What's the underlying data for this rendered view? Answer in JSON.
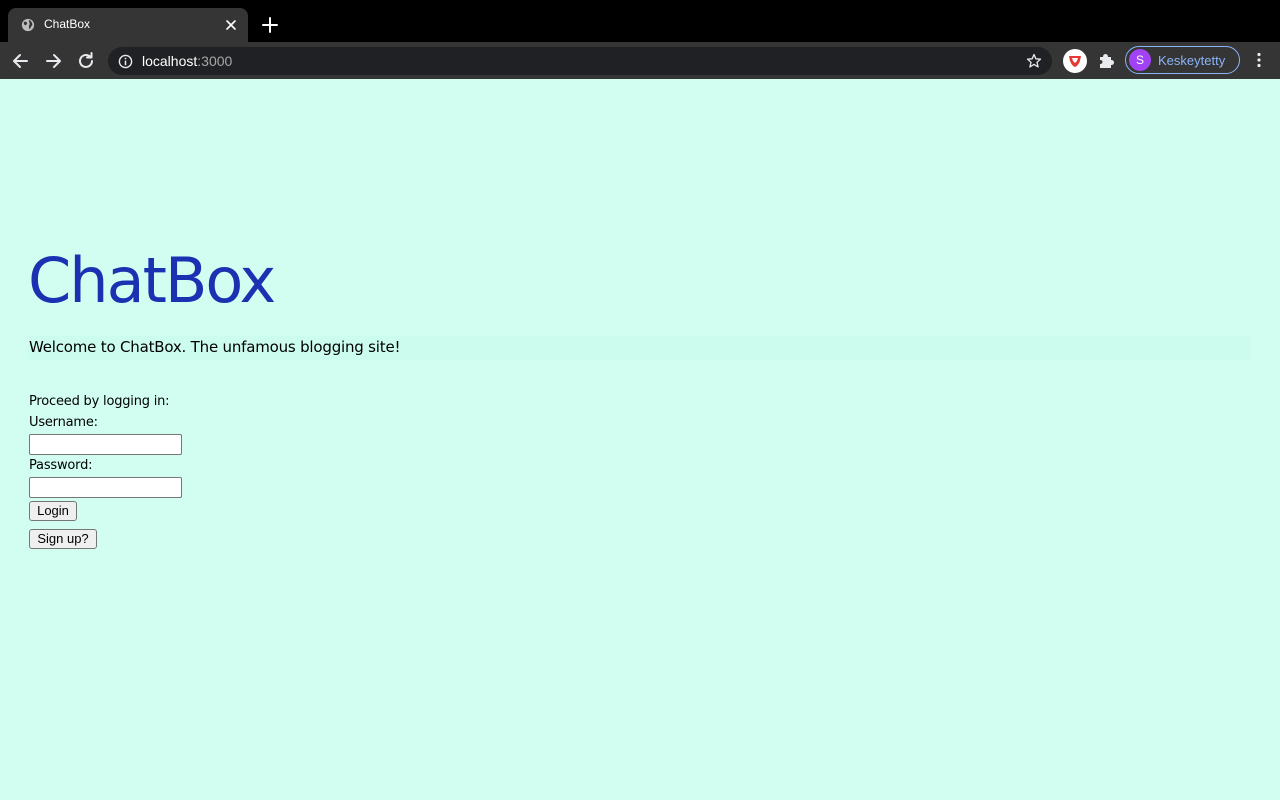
{
  "browser": {
    "tab": {
      "title": "ChatBox",
      "favicon": "globe-icon",
      "close": "close-icon"
    },
    "new_tab": "plus-icon",
    "toolbar": {
      "back": "arrow-left-icon",
      "forward": "arrow-right-icon",
      "reload": "reload-icon"
    },
    "address": {
      "host": "localhost",
      "port": ":3000",
      "info": "info-icon",
      "bookmark": "star-icon"
    },
    "extensions": [
      "shield-extension-icon",
      "puzzle-icon"
    ],
    "profile": {
      "initial": "S",
      "name": "Keskeytetty"
    },
    "menu": "kebab-menu-icon"
  },
  "page": {
    "title": "ChatBox",
    "welcome": "Welcome to ChatBox. The unfamous blogging site!",
    "login": {
      "prompt": "Proceed by logging in:",
      "username_label": "Username:",
      "username_value": "",
      "password_label": "Password:",
      "password_value": "",
      "login_button": "Login",
      "signup_button": "Sign up?"
    }
  },
  "colors": {
    "page_background": "#d2fef2",
    "title_color": "#1a31b1",
    "tab_background": "#353535",
    "tabstrip_background": "#000000",
    "profile_accent": "#8ab4f8",
    "avatar_color": "#a142f4"
  }
}
